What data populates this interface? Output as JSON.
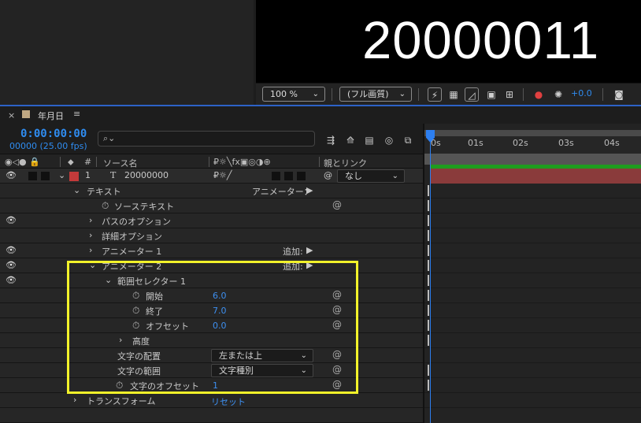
{
  "viewer": {
    "display_text": "20000011",
    "zoom": "100 %",
    "resolution": "(フル画質)",
    "exposure_value": "+0.0"
  },
  "tab": {
    "title": "年月日"
  },
  "timecode": {
    "time": "0:00:00:00",
    "frames": "00000 (25.00 fps)"
  },
  "search": {
    "placeholder": "",
    "icon": "search-icon"
  },
  "columns": {
    "source_name": "ソース名",
    "number": "#",
    "parent_link": "親とリンク"
  },
  "ruler": {
    "ticks": [
      "0s",
      "01s",
      "02s",
      "03s",
      "04s"
    ]
  },
  "layer": {
    "number": "1",
    "type_glyph": "T",
    "name": "20000000",
    "parent_value": "なし"
  },
  "rows": {
    "text_group": "テキスト",
    "animator_label": "アニメーター：",
    "source_text": "ソーステキスト",
    "path_options": "パスのオプション",
    "more_options": "詳細オプション",
    "animator1": "アニメーター 1",
    "add1": "追加:",
    "animator2": "アニメーター 2",
    "add2": "追加:",
    "range_selector": "範囲セレクター 1",
    "start": "開始",
    "start_value": "6.0",
    "end": "終了",
    "end_value": "7.0",
    "offset": "オフセット",
    "offset_value": "0.0",
    "advanced": "高度",
    "anchor_grouping": "文字の配置",
    "anchor_grouping_value": "左または上",
    "char_range": "文字の範囲",
    "char_range_value": "文字種別",
    "char_offset": "文字のオフセット",
    "char_offset_value": "1",
    "transform": "トランスフォーム",
    "reset": "リセット"
  },
  "colors": {
    "accent_blue": "#2f8cf0",
    "highlight_yellow": "#f2f22a",
    "layer_label_red": "#c33a3a",
    "layer_bar": "#8a3b3b"
  }
}
